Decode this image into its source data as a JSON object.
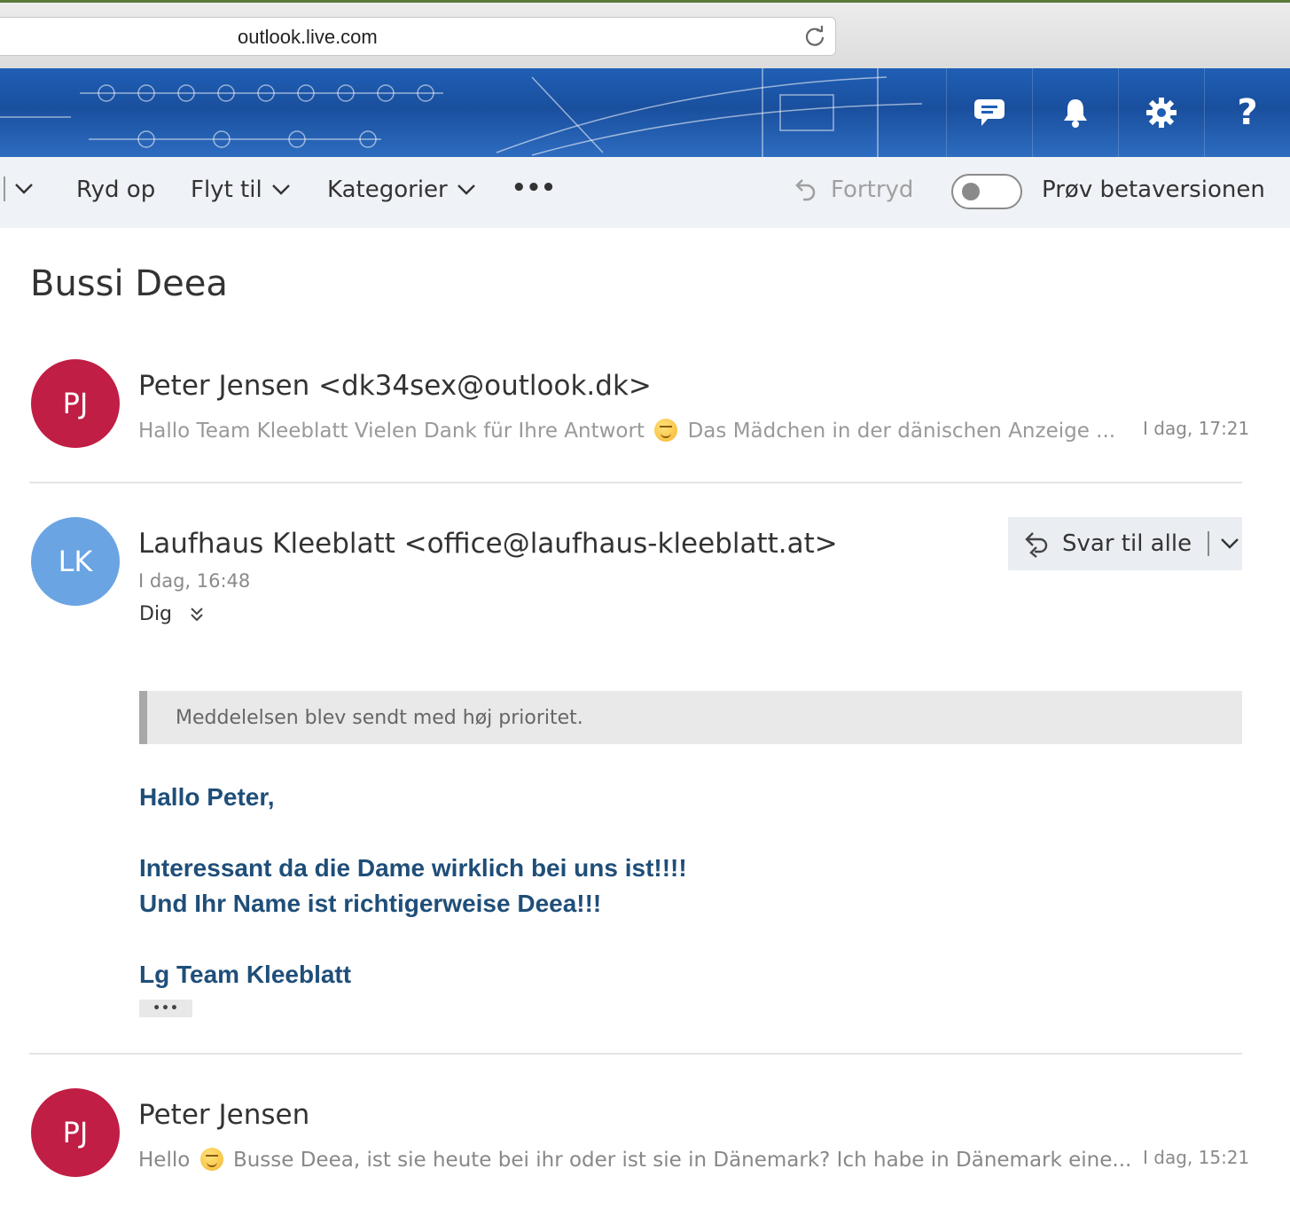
{
  "browser": {
    "url": "outlook.live.com"
  },
  "header": {
    "icons": [
      "chat-icon",
      "bell-icon",
      "gear-icon",
      "help-icon"
    ],
    "help_glyph": "?"
  },
  "toolbar": {
    "ryd_op": "Ryd op",
    "flyt_til": "Flyt til",
    "kategorier": "Kategorier",
    "more": "•••",
    "fortryd": "Fortryd",
    "beta_label": "Prøv betaversionen"
  },
  "thread": {
    "subject": "Bussi Deea",
    "messages": [
      {
        "initials": "PJ",
        "sender": "Peter Jensen <dk34sex@outlook.dk>",
        "preview_part1": "Hallo Team Kleeblatt Vielen Dank für Ihre Antwort",
        "preview_part2": "Das Mädchen in der dänischen Anzeige ...",
        "time": "I dag, 17:21"
      },
      {
        "initials": "LK",
        "sender": "Laufhaus Kleeblatt <office@laufhaus-kleeblatt.at>",
        "time": "I dag, 16:48",
        "to": "Dig",
        "reply_all_label": "Svar til alle",
        "priority_notice": "Meddelelsen blev sendt med høj prioritet.",
        "body": [
          "Hallo Peter,",
          "Interessant da die Dame wirklich bei uns ist!!!!",
          "Und Ihr Name ist richtigerweise Deea!!!",
          "Lg Team Kleeblatt"
        ],
        "more_label": "•••"
      },
      {
        "initials": "PJ",
        "sender": "Peter Jensen",
        "preview_part1": "Hello",
        "preview_part2": "Busse Deea, ist sie heute bei ihr oder ist sie in Dänemark? Ich habe in Dänemark eine...",
        "time": "I dag, 15:21"
      }
    ]
  },
  "colors": {
    "accent_pj": "#c01e44",
    "accent_lk": "#6aa4e3",
    "body_text": "#1f4e79",
    "header_blue": "#1f5fb5"
  }
}
